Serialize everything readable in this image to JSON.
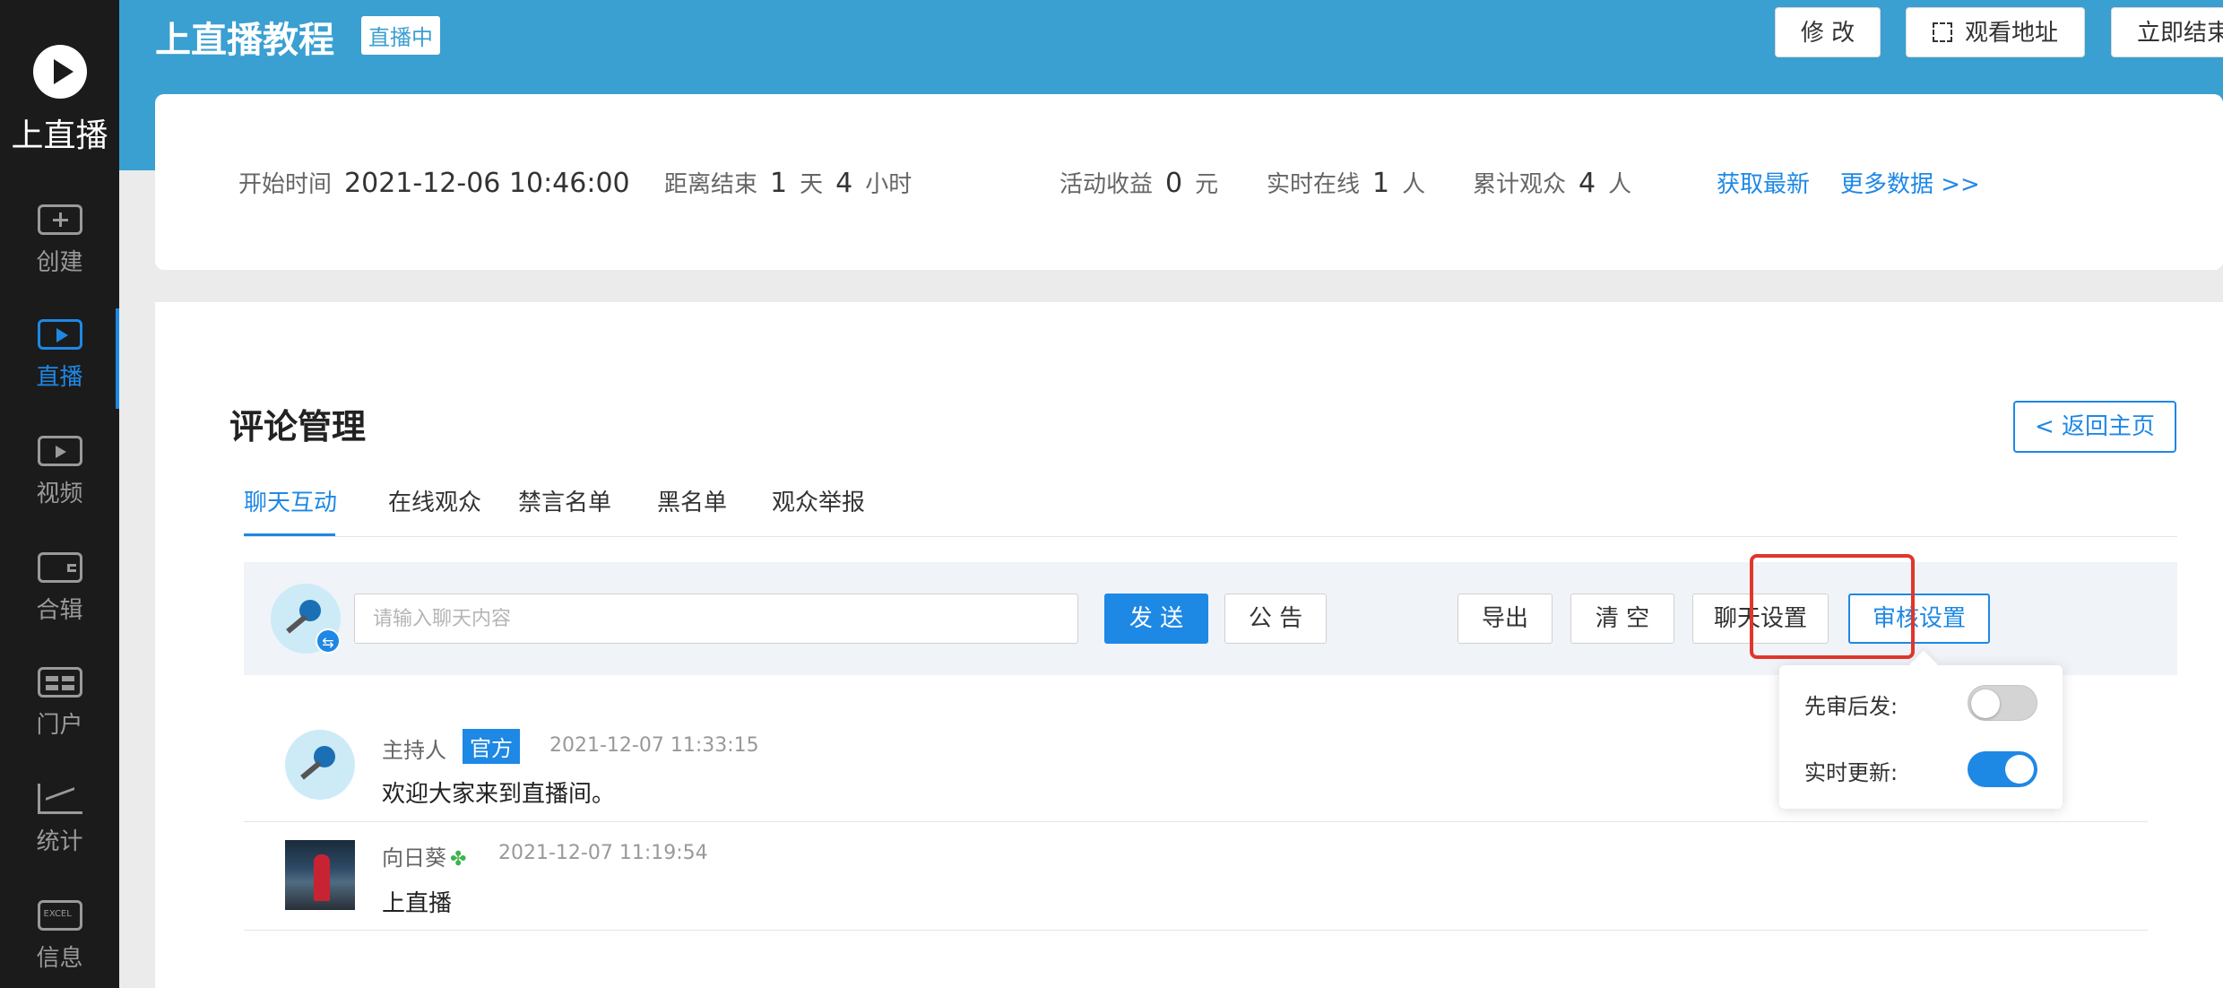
{
  "sidebar": {
    "brand": "上直播",
    "items": [
      {
        "label": "创建",
        "icon": "plus-box-icon"
      },
      {
        "label": "直播",
        "icon": "live-play-icon",
        "active": true
      },
      {
        "label": "视频",
        "icon": "film-icon"
      },
      {
        "label": "合辑",
        "icon": "wallet-icon"
      },
      {
        "label": "门户",
        "icon": "portal-icon"
      },
      {
        "label": "统计",
        "icon": "stats-chart-icon"
      },
      {
        "label": "信息",
        "icon": "excel-icon"
      }
    ]
  },
  "header": {
    "title": "上直播教程",
    "status_badge": "直播中",
    "buttons": {
      "modify": "修 改",
      "watch_url": "观看地址",
      "end_now": "立即结束"
    }
  },
  "stats": {
    "start_label": "开始时间",
    "start_value": "2021-12-06 10:46:00",
    "countdown_label": "距离结束",
    "countdown_days": "1",
    "days_unit": "天",
    "countdown_hours": "4",
    "hours_unit": "小时",
    "revenue_label": "活动收益",
    "revenue_value": "0",
    "revenue_unit": "元",
    "online_label": "实时在线",
    "online_value": "1",
    "online_unit": "人",
    "total_label": "累计观众",
    "total_value": "4",
    "total_unit": "人",
    "refresh_link": "获取最新",
    "more_link": "更多数据 >>"
  },
  "comments": {
    "title": "评论管理",
    "back_button": "< 返回主页",
    "tabs": [
      "聊天互动",
      "在线观众",
      "禁言名单",
      "黑名单",
      "观众举报"
    ],
    "active_tab": 0,
    "chat_bar": {
      "placeholder": "请输入聊天内容",
      "send": "发 送",
      "notice": "公 告",
      "export": "导出",
      "clear": "清 空",
      "chat_settings": "聊天设置",
      "review_settings": "审核设置"
    },
    "messages": [
      {
        "name": "主持人",
        "badge": "官方",
        "time": "2021-12-07 11:33:15",
        "text": "欢迎大家来到直播间。"
      },
      {
        "name": "向日葵",
        "time": "2021-12-07 11:19:54",
        "text": "上直播"
      }
    ],
    "review_popover": {
      "review_first_label": "先审后发:",
      "review_first_on": false,
      "realtime_label": "实时更新:",
      "realtime_on": true
    }
  },
  "colors": {
    "accent": "#1e88e5",
    "header": "#3a9fd1",
    "sidebar": "#1b1b1b",
    "highlight": "#e0362b"
  }
}
